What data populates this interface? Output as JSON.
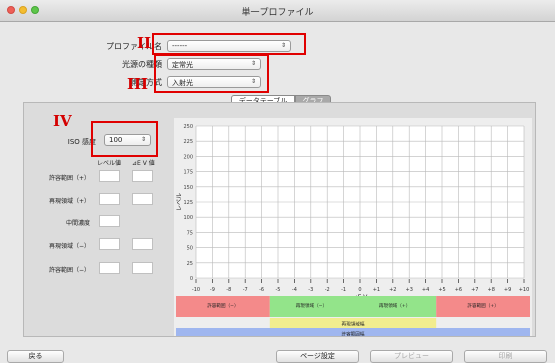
{
  "window": {
    "title": "単一プロファイル"
  },
  "form": {
    "profile_name_label": "プロファイル名",
    "profile_name_value": "------",
    "light_source_label": "光源の種類",
    "light_source_value": "定常光",
    "metering_label": "測定方式",
    "metering_value": "入射光"
  },
  "annotations": {
    "ii": "II",
    "iii": "III",
    "iv": "IV"
  },
  "tabs": {
    "data_table": "データテーブル",
    "graph": "グラフ"
  },
  "iso": {
    "label": "ISO 感度",
    "value": "100"
  },
  "columns": {
    "level": "レベル値",
    "ev": "⊿E V 値"
  },
  "rows": [
    {
      "label": "許容範囲（+）",
      "fields": 2
    },
    {
      "label": "再現領域（+）",
      "fields": 2
    },
    {
      "label": "中間濃度",
      "fields": 1
    },
    {
      "label": "再現領域（−）",
      "fields": 2
    },
    {
      "label": "許容範囲（−）",
      "fields": 2
    }
  ],
  "chart_data": {
    "type": "heatmap",
    "ylabel": "レベル",
    "xlabel": "⊿E V",
    "y_ticks": [
      "250",
      "225",
      "200",
      "175",
      "150",
      "125",
      "100",
      "75",
      "50",
      "25",
      "0"
    ],
    "x_ticks": [
      "-10",
      "-9",
      "-8",
      "-7",
      "-6",
      "-5",
      "-4",
      "-3",
      "-2",
      "-1",
      "0",
      "+1",
      "+2",
      "+3",
      "+4",
      "+5",
      "+6",
      "+7",
      "+8",
      "+9",
      "+10"
    ],
    "ylim": [
      0,
      250
    ],
    "xlim": [
      -10,
      10
    ],
    "grid": true,
    "bands": [
      {
        "label": "許容範囲（−）",
        "color": "#f48a8a",
        "x0": -10,
        "x1": -4.7,
        "row": 0
      },
      {
        "label": "再現領域（−）",
        "color": "#93e48a",
        "x0": -4.7,
        "x1": 0,
        "row": 0
      },
      {
        "label": "再現領域（+）",
        "color": "#93e48a",
        "x0": 0,
        "x1": 4.7,
        "row": 0
      },
      {
        "label": "許容範囲（+）",
        "color": "#f48a8a",
        "x0": 4.7,
        "x1": 10,
        "row": 0
      },
      {
        "label": "再現領域幅",
        "color": "#f2ed8e",
        "x0": -4.7,
        "x1": 4.7,
        "row": 1
      },
      {
        "label": "許容範囲幅",
        "color": "#9fb6ef",
        "x0": -10,
        "x1": 10,
        "row": 2
      }
    ]
  },
  "buttons": {
    "back": "戻る",
    "page_setup": "ページ設定",
    "preview": "プレビュー",
    "print": "印刷"
  }
}
